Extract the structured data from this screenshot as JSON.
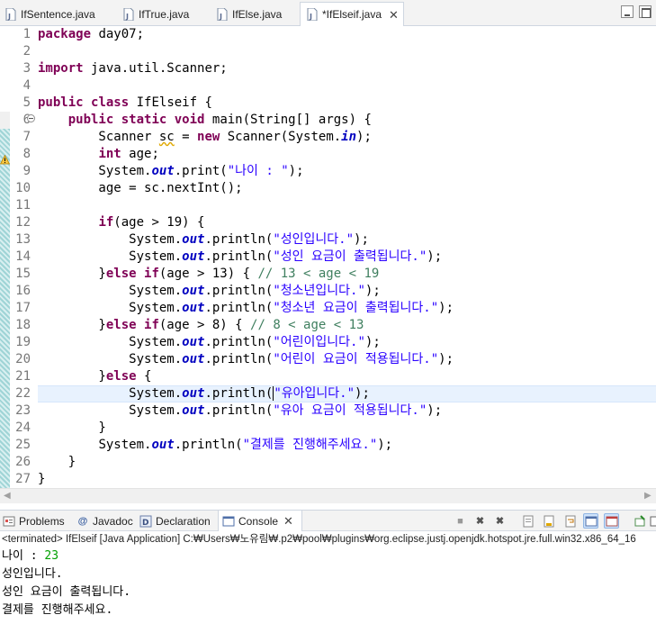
{
  "editor_tabs": [
    {
      "label": "IfSentence.java"
    },
    {
      "label": "IfTrue.java"
    },
    {
      "label": "IfElse.java"
    },
    {
      "label": "*IfElseif.java"
    }
  ],
  "line_numbers": [
    "1",
    "2",
    "3",
    "4",
    "5",
    "6",
    "7",
    "8",
    "9",
    "10",
    "11",
    "12",
    "13",
    "14",
    "15",
    "16",
    "17",
    "18",
    "19",
    "20",
    "21",
    "22",
    "23",
    "24",
    "25",
    "26",
    "27"
  ],
  "code": {
    "l1_kw": "package",
    "l1_rest": " day07;",
    "l3_kw": "import",
    "l3_rest": " java.util.Scanner;",
    "l5_kw1": "public",
    "l5_kw2": "class",
    "l5_rest": " IfElseif {",
    "l6_kw1": "public",
    "l6_kw2": "static",
    "l6_kw3": "void",
    "l6_rest": " main(String[] args) {",
    "l7_a": "        Scanner ",
    "l7_var": "sc",
    "l7_b": " = ",
    "l7_kw": "new",
    "l7_c": " Scanner(System.",
    "l7_fld": "in",
    "l7_d": ");",
    "l8_kw": "int",
    "l8_rest": " age;",
    "l9_a": "        System.",
    "l9_fld": "out",
    "l9_b": ".print(",
    "l9_str": "\"나이 : \"",
    "l9_c": ");",
    "l10": "        age = sc.nextInt();",
    "l12_kw": "if",
    "l12_rest": "(age > 19) {",
    "l13_str": "\"성인입니다.\"",
    "l14_str": "\"성인 요금이 출력됩니다.\"",
    "l15_a": "        }",
    "l15_kw1": "else",
    "l15_kw2": "if",
    "l15_b": "(age > 13) { ",
    "l15_cmt": "// 13 < age < 19",
    "l16_str": "\"청소년입니다.\"",
    "l17_str": "\"청소년 요금이 출력됩니다.\"",
    "l18_a": "        }",
    "l18_kw1": "else",
    "l18_kw2": "if",
    "l18_b": "(age > 8) { ",
    "l18_cmt": "// 8 < age < 13",
    "l19_str": "\"어린이입니다.\"",
    "l20_str": "\"어린이 요금이 적용됩니다.\"",
    "l21_a": "        }",
    "l21_kw": "else",
    "l21_b": " {",
    "l22_str": "\"유아입니다.\"",
    "l23_str": "\"유아 요금이 적용됩니다.\"",
    "l24": "        }",
    "l25_str": "\"결제를 진행해주세요.\"",
    "l26": "    }",
    "l27": "}",
    "sys": "System.",
    "out": "out",
    "println": ".println(",
    "close": ");"
  },
  "panel_tabs": [
    {
      "label": "Problems",
      "icon": "problems-icon"
    },
    {
      "label": "Javadoc",
      "icon": "javadoc-icon"
    },
    {
      "label": "Declaration",
      "icon": "declaration-icon"
    },
    {
      "label": "Console",
      "icon": "console-icon"
    }
  ],
  "console_status": "<terminated> IfElseif [Java Application] C:₩Users₩노유림₩.p2₩pool₩plugins₩org.eclipse.justj.openjdk.hotspot.jre.full.win32.x86_64_16",
  "console_output": {
    "prompt": "나이 : ",
    "input": "23",
    "line2": "성인입니다.",
    "line3": "성인 요금이 출력됩니다.",
    "line4": "결제를 진행해주세요."
  },
  "colors": {
    "keyword": "#7f0055",
    "string": "#2a00ff",
    "comment": "#3f7f5f",
    "field": "#0000c0",
    "line_highlight": "#e8f2fe"
  }
}
